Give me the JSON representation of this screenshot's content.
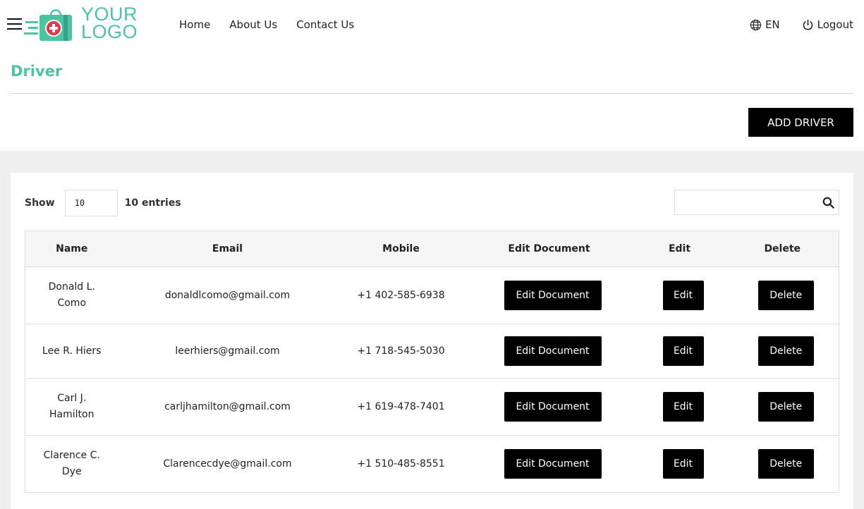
{
  "header": {
    "logo": {
      "line1": "YOUR",
      "line2": "LOGO",
      "accent": "#4cc4a2"
    },
    "nav": [
      {
        "label": "Home"
      },
      {
        "label": "About Us"
      },
      {
        "label": "Contact Us"
      }
    ],
    "language": {
      "icon": "globe-icon",
      "label": "EN"
    },
    "logout": {
      "icon": "power-icon",
      "label": "Logout"
    }
  },
  "page": {
    "title": "Driver",
    "add_button": "ADD DRIVER"
  },
  "table_controls": {
    "show_label": "Show",
    "entries_value": "10",
    "entries_label": "10 entries",
    "search_placeholder": ""
  },
  "table": {
    "columns": [
      "Name",
      "Email",
      "Mobile",
      "Edit Document",
      "Edit",
      "Delete"
    ],
    "rows": [
      {
        "name_line1": "Donald L.",
        "name_line2": "Como",
        "email": "donaldlcomo@gmail.com",
        "mobile": "+1 402-585-6938",
        "doc": "Edit Document",
        "edit": "Edit",
        "delete": "Delete"
      },
      {
        "name_line1": "Lee R. Hiers",
        "name_line2": "",
        "email": "leerhiers@gmail.com",
        "mobile": "+1 718-545-5030",
        "doc": "Edit Document",
        "edit": "Edit",
        "delete": "Delete"
      },
      {
        "name_line1": "Carl J.",
        "name_line2": "Hamilton",
        "email": "carljhamilton@gmail.com",
        "mobile": "+1 619-478-7401",
        "doc": "Edit Document",
        "edit": "Edit",
        "delete": "Delete"
      },
      {
        "name_line1": "Clarence C.",
        "name_line2": "Dye",
        "email": "Clarencecdye@gmail.com",
        "mobile": "+1 510-485-8551",
        "doc": "Edit Document",
        "edit": "Edit",
        "delete": "Delete"
      }
    ]
  }
}
